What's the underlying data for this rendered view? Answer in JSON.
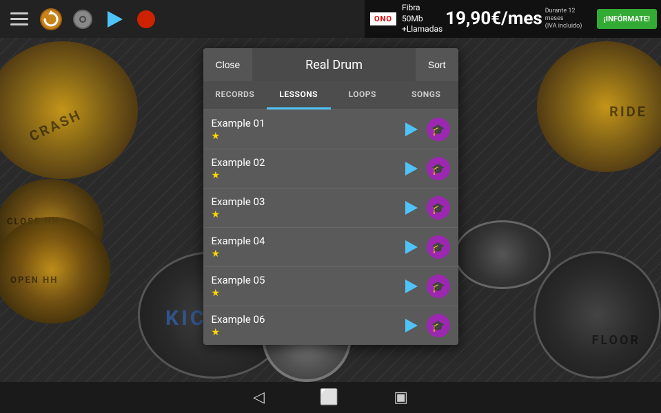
{
  "topbar": {
    "icons": [
      "menu",
      "refresh",
      "settings",
      "play",
      "record"
    ]
  },
  "ad": {
    "brand": "ONO",
    "line1": "Fibra 50Mb",
    "line2": "+Llamadas",
    "price": "19,90€/mes",
    "subtext1": "Durante 12 meses",
    "subtext2": "(IVA incluido)",
    "cta": "¡INFÓRMATE!"
  },
  "modal": {
    "close_label": "Close",
    "title": "Real Drum",
    "sort_label": "Sort",
    "tabs": [
      {
        "id": "records",
        "label": "RECORDS",
        "active": false
      },
      {
        "id": "lessons",
        "label": "LESSONS",
        "active": true
      },
      {
        "id": "loops",
        "label": "LOOPS",
        "active": false
      },
      {
        "id": "songs",
        "label": "SONGS",
        "active": false
      }
    ],
    "items": [
      {
        "title": "Example 01",
        "star": "★",
        "id": 1
      },
      {
        "title": "Example 02",
        "star": "★",
        "id": 2
      },
      {
        "title": "Example 03",
        "star": "★",
        "id": 3
      },
      {
        "title": "Example 04",
        "star": "★",
        "id": 4
      },
      {
        "title": "Example 05",
        "star": "★",
        "id": 5
      },
      {
        "title": "Example 06",
        "star": "★",
        "id": 6
      }
    ]
  },
  "bottomnav": {
    "back_icon": "◁",
    "home_icon": "⬜",
    "recent_icon": "▣"
  },
  "drums": {
    "crash_label": "CRASH",
    "ride_label": "RIDE",
    "hihat_open_label": "OPEN HH",
    "hihat_close_label": "CLOSE HH",
    "kick_label": "Kick",
    "floor_label": "FLOOR"
  }
}
